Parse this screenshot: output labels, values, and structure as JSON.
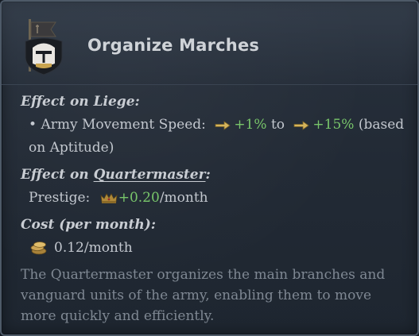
{
  "title": "Organize Marches",
  "liege": {
    "header": "Effect on Liege:",
    "bullet": "•",
    "stat_label": "Army Movement Speed:",
    "value_min": "+1%",
    "to_word": "to",
    "value_max": "+15%",
    "based_on": "(based on Aptitude)"
  },
  "quartermaster": {
    "header_prefix": "Effect on ",
    "header_link": "Quartermaster",
    "header_suffix": ":",
    "stat_label": "Prestige:",
    "value": "+0.20",
    "per": "/month"
  },
  "cost": {
    "header": "Cost (per month):",
    "value": "0.12/month"
  },
  "description": "The Quartermaster organizes the main branches and vanguard units of the army, enabling them to move more quickly and efficiently.",
  "icons": {
    "emblem": "banner-helmet-icon",
    "movement": "arrow-right-icon",
    "prestige": "crown-icon",
    "gold": "gold-coins-icon"
  },
  "colors": {
    "positive": "#78c56a",
    "text": "#c3c8cf",
    "muted": "#7f8893"
  }
}
